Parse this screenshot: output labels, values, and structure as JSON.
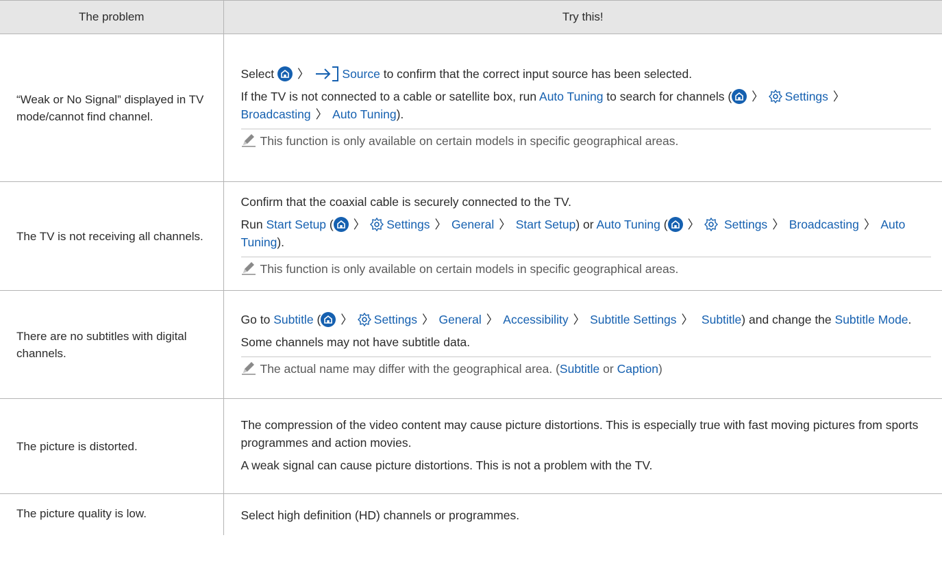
{
  "header": {
    "problem": "The problem",
    "solution": "Try this!"
  },
  "rows": [
    {
      "problem": "“Weak or No Signal” displayed in TV mode/cannot find channel.",
      "p1_a": "Select",
      "p1_source": "Source",
      "p1_b": "to confirm that the correct input source has been selected.",
      "p2_a": "If the TV is not connected to a cable or satellite box, run",
      "p2_auto": "Auto Tuning",
      "p2_b": "to search for channels (",
      "p2_settings": "Settings",
      "p2_broadcasting": "Broadcasting",
      "p2_auto2": "Auto Tuning",
      "p2_c": ").",
      "note": "This function is only available on certain models in specific geographical areas."
    },
    {
      "problem": "The TV is not receiving all channels.",
      "p1": "Confirm that the coaxial cable is securely connected to the TV.",
      "p2_run": "Run",
      "p2_start": "Start Setup",
      "p2_open": "(",
      "p2_settings": "Settings",
      "p2_general": "General",
      "p2_start2": "Start Setup",
      "p2_or": ") or",
      "p2_auto": "Auto Tuning",
      "p2_open2": "(",
      "p2_settings2": "Settings",
      "p2_broadcasting": "Broadcasting",
      "p2_auto2": "Auto Tuning",
      "p2_close": ").",
      "note": "This function is only available on certain models in specific geographical areas."
    },
    {
      "problem": "There are no subtitles with digital channels.",
      "p1_go": "Go to",
      "p1_subtitle": "Subtitle",
      "p1_open": "(",
      "p1_settings": "Settings",
      "p1_general": "General",
      "p1_access": "Accessibility",
      "p1_subset": "Subtitle Settings",
      "p1_subtitle2": "Subtitle",
      "p1_change": ") and change the",
      "p1_mode": "Subtitle Mode",
      "p1_end": ".",
      "p2": "Some channels may not have subtitle data.",
      "note_a": "The actual name may differ with the geographical area. (",
      "note_subtitle": "Subtitle",
      "note_or": "or",
      "note_caption": "Caption",
      "note_end": ")"
    },
    {
      "problem": "The picture is distorted.",
      "p1": "The compression of the video content may cause picture distortions. This is especially true with fast moving pictures from sports programmes and action movies.",
      "p2": "A weak signal can cause picture distortions. This is not a problem with the TV."
    },
    {
      "problem": "The picture quality is low.",
      "p1": "Select high definition (HD) channels or programmes."
    }
  ],
  "chevron": "〉",
  "colors": {
    "link": "#1560b0",
    "header_bg": "#e6e6e6",
    "border": "#b4b4b4"
  },
  "icons": [
    "home-icon",
    "source-icon",
    "gear-icon",
    "pencil-icon"
  ]
}
